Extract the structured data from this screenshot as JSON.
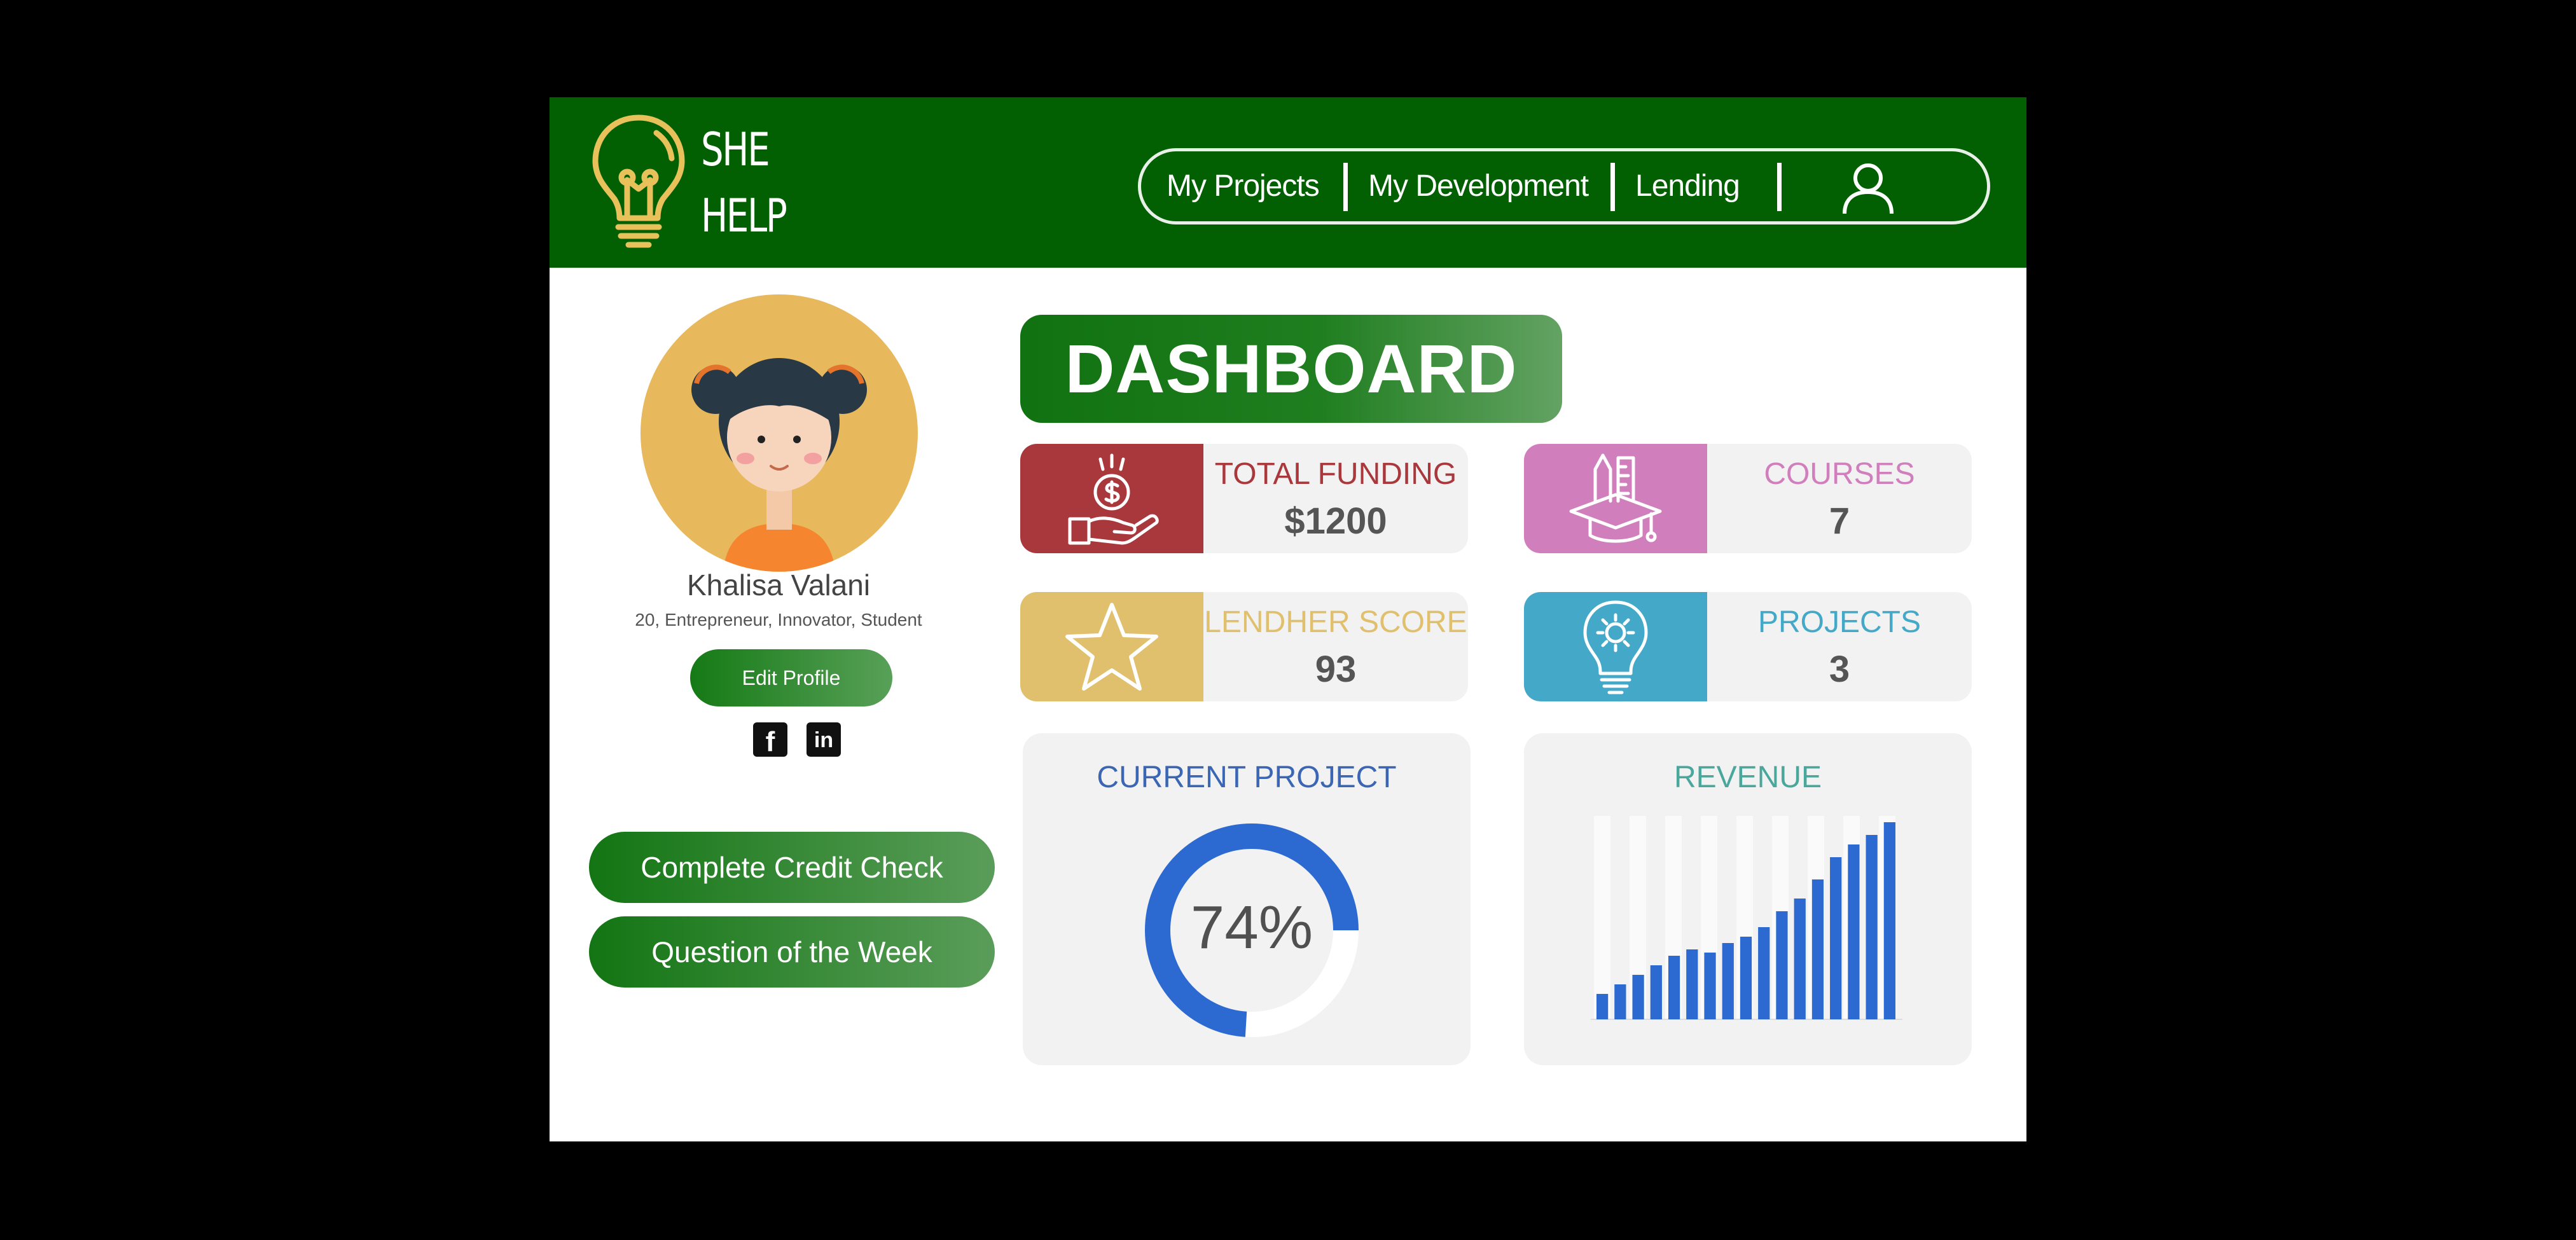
{
  "brand": {
    "line1": "SHE",
    "line2": "HELP",
    "color": "#e9c15b"
  },
  "nav": {
    "items": [
      {
        "label": "My Projects"
      },
      {
        "label": "My Development"
      },
      {
        "label": "Lending"
      }
    ],
    "user_icon": "user-icon"
  },
  "profile": {
    "name": "Khalisa Valani",
    "tagline": "20, Entrepreneur, Innovator, Student",
    "edit_label": "Edit Profile",
    "social": [
      {
        "name": "facebook-icon",
        "glyph": "f"
      },
      {
        "name": "linkedin-icon",
        "glyph": "in"
      }
    ]
  },
  "actions": {
    "credit_check": "Complete Credit Check",
    "question_week": "Question of the Week"
  },
  "dashboard": {
    "title": "DASHBOARD",
    "cards": {
      "funding": {
        "label": "TOTAL FUNDING",
        "value": "$1200",
        "color": "#a9383d",
        "icon": "money-hand-icon"
      },
      "courses": {
        "label": "COURSES",
        "value": "7",
        "color": "#d07ebc",
        "icon": "graduation-cap-icon"
      },
      "score": {
        "label": "LENDHER SCORE",
        "value": "93",
        "color": "#e0c06d",
        "icon": "star-icon"
      },
      "projects": {
        "label": "PROJECTS",
        "value": "3",
        "color": "#44a9c9",
        "icon": "lightbulb-gear-icon"
      }
    },
    "current_project": {
      "title": "CURRENT PROJECT",
      "percent_label": "74%",
      "percent": 74,
      "title_color": "#3a66b4",
      "ring_color": "#2c6ad2"
    },
    "revenue": {
      "title": "REVENUE",
      "title_color": "#4aa79c"
    }
  },
  "chart_data": {
    "type": "bar",
    "title": "REVENUE",
    "values": [
      8,
      11,
      14,
      17,
      20,
      22,
      21,
      24,
      26,
      29,
      34,
      38,
      44,
      51,
      55,
      58,
      62
    ]
  }
}
